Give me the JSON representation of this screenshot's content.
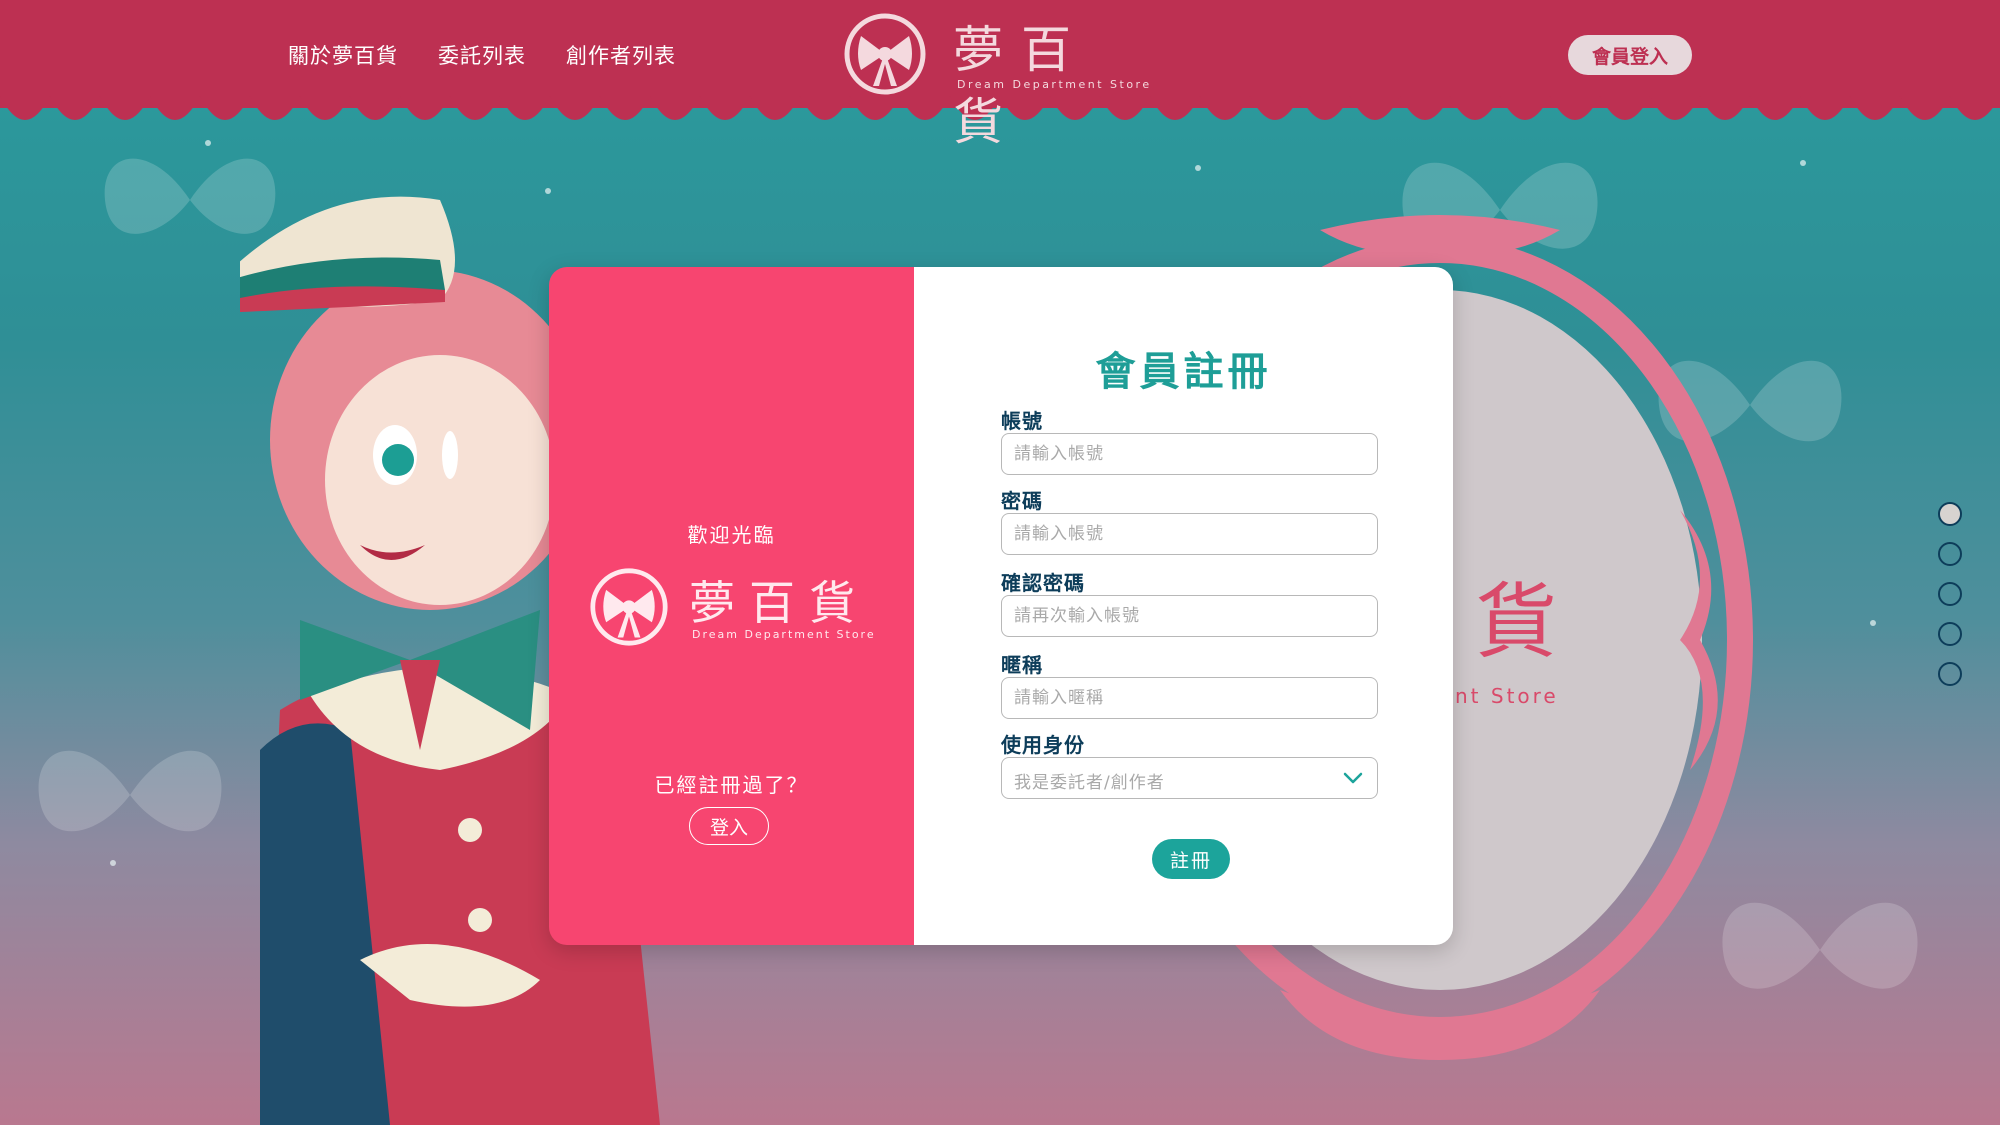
{
  "header": {
    "nav": [
      "關於夢百貨",
      "委託列表",
      "創作者列表"
    ],
    "logo_title": "夢百貨",
    "logo_subtitle": "Dream Department Store",
    "login_label": "會員登入"
  },
  "background": {
    "mirror_title": "貨",
    "mirror_subtitle": "nt Store"
  },
  "modal": {
    "left": {
      "welcome": "歡迎光臨",
      "logo_title": "夢百貨",
      "logo_subtitle": "Dream Department Store",
      "already_registered": "已經註冊過了？",
      "login_label": "登入"
    },
    "form": {
      "title": "會員註冊",
      "account_label": "帳號",
      "account_placeholder": "請輸入帳號",
      "password_label": "密碼",
      "password_placeholder": "請輸入帳號",
      "confirm_label": "確認密碼",
      "confirm_placeholder": "請再次輸入帳號",
      "nickname_label": "暱稱",
      "nickname_placeholder": "請輸入暱稱",
      "role_label": "使用身份",
      "role_selected": "我是委託者/創作者",
      "submit_label": "註冊"
    }
  },
  "pagination": {
    "count": 5,
    "active_index": 0
  },
  "colors": {
    "header": "#bd3052",
    "modal_left": "#f74570",
    "accent_teal": "#1ca49b",
    "label_navy": "#0d3d5a"
  }
}
